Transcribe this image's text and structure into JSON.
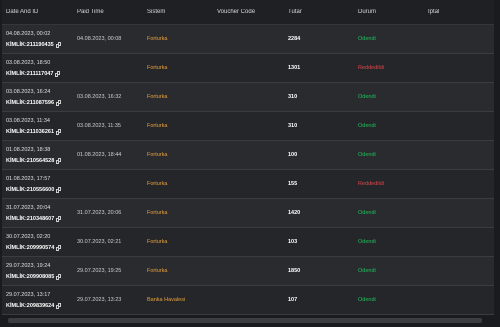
{
  "table": {
    "columns": [
      "Date And ID",
      "Paid Time",
      "Sistem",
      "Voucher Code",
      "Tutar",
      "Durum",
      "İptal"
    ],
    "rows": [
      {
        "date": "04.08.2023, 00:02",
        "kimlik": "KİMLİK:211190435",
        "paid_time": "04.08.2023, 00:08",
        "sistem": "Forturka",
        "voucher": "",
        "tutar": "2284",
        "durum": "Ödendi",
        "status": "ok"
      },
      {
        "date": "03.08.2023, 18:50",
        "kimlik": "KİMLİK:211117047",
        "paid_time": "",
        "sistem": "Forturka",
        "voucher": "",
        "tutar": "1301",
        "durum": "Reddedildi",
        "status": "bad"
      },
      {
        "date": "03.08.2023, 16:24",
        "kimlik": "KİMLİK:211087596",
        "paid_time": "03.08.2023, 16:32",
        "sistem": "Forturka",
        "voucher": "",
        "tutar": "310",
        "durum": "Ödendi",
        "status": "ok"
      },
      {
        "date": "03.08.2023, 11:34",
        "kimlik": "KİMLİK:211036261",
        "paid_time": "03.08.2023, 11:35",
        "sistem": "Forturka",
        "voucher": "",
        "tutar": "310",
        "durum": "Ödendi",
        "status": "ok"
      },
      {
        "date": "01.08.2023, 18:38",
        "kimlik": "KİMLİK:210564528",
        "paid_time": "01.08.2023, 18:44",
        "sistem": "Forturka",
        "voucher": "",
        "tutar": "100",
        "durum": "Ödendi",
        "status": "ok"
      },
      {
        "date": "01.08.2023, 17:57",
        "kimlik": "KİMLİK:210556600",
        "paid_time": "",
        "sistem": "Forturka",
        "voucher": "",
        "tutar": "155",
        "durum": "Reddedildi",
        "status": "bad"
      },
      {
        "date": "31.07.2023, 20:04",
        "kimlik": "KİMLİK:210348607",
        "paid_time": "31.07.2023, 20:06",
        "sistem": "Forturka",
        "voucher": "",
        "tutar": "1420",
        "durum": "Ödendi",
        "status": "ok"
      },
      {
        "date": "30.07.2023, 02:20",
        "kimlik": "KİMLİK:209990574",
        "paid_time": "30.07.2023, 02:21",
        "sistem": "Forturka",
        "voucher": "",
        "tutar": "103",
        "durum": "Ödendi",
        "status": "ok"
      },
      {
        "date": "29.07.2023, 19:24",
        "kimlik": "KİMLİK:209908085",
        "paid_time": "29.07.2023, 19:25",
        "sistem": "Forturka",
        "voucher": "",
        "tutar": "1850",
        "durum": "Ödendi",
        "status": "ok"
      },
      {
        "date": "29.07.2023, 13:17",
        "kimlik": "KİMLİK:209839624",
        "paid_time": "29.07.2023, 13:23",
        "sistem": "Banka Havalesi",
        "voucher": "",
        "tutar": "107",
        "durum": "Ödendi",
        "status": "ok"
      }
    ]
  },
  "icons": {
    "copy": "copy-icon"
  },
  "colors": {
    "background": "#1a1b1e",
    "sistem": "#e9a23b",
    "paid": "#20c05a",
    "rejected": "#e04646"
  }
}
